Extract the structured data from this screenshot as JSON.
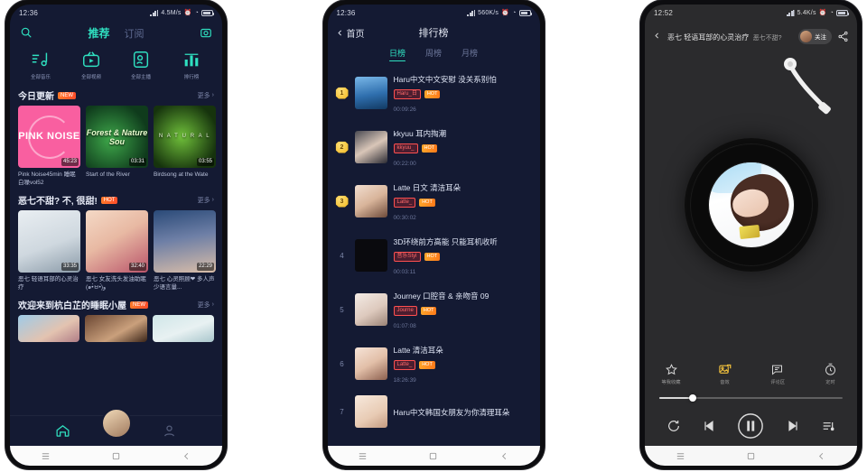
{
  "phone1": {
    "status": {
      "time": "12:36",
      "speed": "4.5M/s",
      "icons": [
        "signal-icon",
        "alarm-icon",
        "wifi-icon",
        "battery-icon"
      ]
    },
    "header": {
      "search_icon": "search-icon",
      "tab_active": "推荐",
      "tab_inactive": "订阅",
      "camera_icon": "camera-icon"
    },
    "quicknav": [
      {
        "icon": "music-note-icon",
        "label": "全部音乐"
      },
      {
        "icon": "tv-icon",
        "label": "全部视频"
      },
      {
        "icon": "person-icon",
        "label": "全部主播"
      },
      {
        "icon": "chart-bars-icon",
        "label": "排行榜"
      }
    ],
    "sections": [
      {
        "title": "今日更新",
        "badge": "NEW",
        "more": "更多",
        "cards": [
          {
            "title": "Pink Noise45min 睡眠白噪vol52",
            "duration": "45:23",
            "art": "pink-noise",
            "art_text": "PINK NOISE"
          },
          {
            "title": "Start of the River",
            "duration": "03:31",
            "art": "forest",
            "art_text": "Forest & Nature Sou"
          },
          {
            "title": "Birdsong at the Wate",
            "duration": "03:55",
            "art": "natural",
            "art_text": "N A T U R A L"
          }
        ]
      },
      {
        "title": "恶七不甜? 不, 很甜!",
        "badge": "HOT",
        "more": "更多",
        "cards": [
          {
            "title": "恶七 轻语耳部的心灵治疗",
            "duration": "33:35",
            "art": "girl1"
          },
          {
            "title": "恶七 女友洗头发油助眠 (๑•̀ㅂ•́)و",
            "duration": "32:40",
            "art": "girl2"
          },
          {
            "title": "恶七 心灵照顾❤ 多人声少语言量...",
            "duration": "22:29",
            "art": "girl3"
          }
        ]
      },
      {
        "title": "欢迎来到杭白芷的睡眠小屋",
        "badge": "NEW",
        "more": "更多",
        "cards": [
          {
            "art": "a1"
          },
          {
            "art": "a2"
          },
          {
            "art": "a3"
          }
        ]
      }
    ],
    "tabbar": [
      {
        "icon": "home-icon",
        "active": true
      },
      {
        "icon": "avatar-center",
        "active": true
      },
      {
        "icon": "user-icon",
        "active": false
      }
    ],
    "andnav": [
      "menu-icon",
      "home-square-icon",
      "back-icon"
    ]
  },
  "phone2": {
    "status": {
      "time": "12:36",
      "speed": "560K/s"
    },
    "header": {
      "back_icon": "chevron-left-icon",
      "back_label": "首页",
      "title": "排行榜"
    },
    "tabs": [
      {
        "label": "日榜",
        "active": true
      },
      {
        "label": "周榜",
        "active": false
      },
      {
        "label": "月榜",
        "active": false
      }
    ],
    "list": [
      {
        "rank": "1",
        "medal": true,
        "title": "Haru中文中文安慰 没关系别怕",
        "tag": "Haru_日",
        "badge": "HOT",
        "duration": "00:09:26",
        "art": "rt1"
      },
      {
        "rank": "2",
        "medal": true,
        "title": "kkyuu 耳内掏潮",
        "tag": "kkyuu_",
        "badge": "HOT",
        "duration": "00:22:00",
        "art": "rt2"
      },
      {
        "rank": "3",
        "medal": true,
        "title": "Latte 日文 清洁耳朵",
        "tag": "Latte_",
        "badge": "HOT",
        "duration": "00:30:02",
        "art": "rt3"
      },
      {
        "rank": "4",
        "medal": false,
        "title": "3D环绕前方高能 只能耳机收听",
        "tag": "音乐Styl",
        "badge": "HOT",
        "duration": "00:03:11",
        "art": "rt4"
      },
      {
        "rank": "5",
        "medal": false,
        "title": "Journey 口腔音 & 亲吻音 09",
        "tag": "Journe",
        "badge": "HOT",
        "duration": "01:07:08",
        "art": "rt5"
      },
      {
        "rank": "6",
        "medal": false,
        "title": "Latte 清洁耳朵",
        "tag": "Latte_",
        "badge": "HOT",
        "duration": "18:26:39",
        "art": "rt6"
      },
      {
        "rank": "7",
        "medal": false,
        "title": "Haru中文韩国女朋友为你清理耳朵",
        "tag": "",
        "badge": "",
        "duration": "",
        "art": "rt7"
      }
    ],
    "andnav": [
      "menu-icon",
      "home-square-icon",
      "back-icon"
    ]
  },
  "phone3": {
    "status": {
      "time": "12:52",
      "speed": "5.4K/s"
    },
    "header": {
      "back_icon": "chevron-left-icon",
      "title_line1": "恶七 轻语耳部的心灵治疗",
      "title_line2": "恶七不甜?",
      "follow_label": "关注",
      "share_icon": "share-icon"
    },
    "player": {
      "disc": "vinyl-record",
      "tonearm": "tonearm-icon"
    },
    "actions": [
      {
        "icon": "star-icon",
        "label": "等我收藏",
        "highlight": false
      },
      {
        "icon": "image-icon",
        "label": "音效",
        "highlight": true
      },
      {
        "icon": "comment-icon",
        "label": "评论区",
        "highlight": false
      },
      {
        "icon": "timer-icon",
        "label": "定时",
        "highlight": false
      }
    ],
    "progress": {
      "percent": 18
    },
    "transport": [
      {
        "icon": "repeat-icon"
      },
      {
        "icon": "previous-icon"
      },
      {
        "icon": "pause-icon"
      },
      {
        "icon": "next-icon"
      },
      {
        "icon": "playlist-icon"
      }
    ],
    "andnav": [
      "menu-icon",
      "home-square-icon",
      "back-icon"
    ]
  }
}
